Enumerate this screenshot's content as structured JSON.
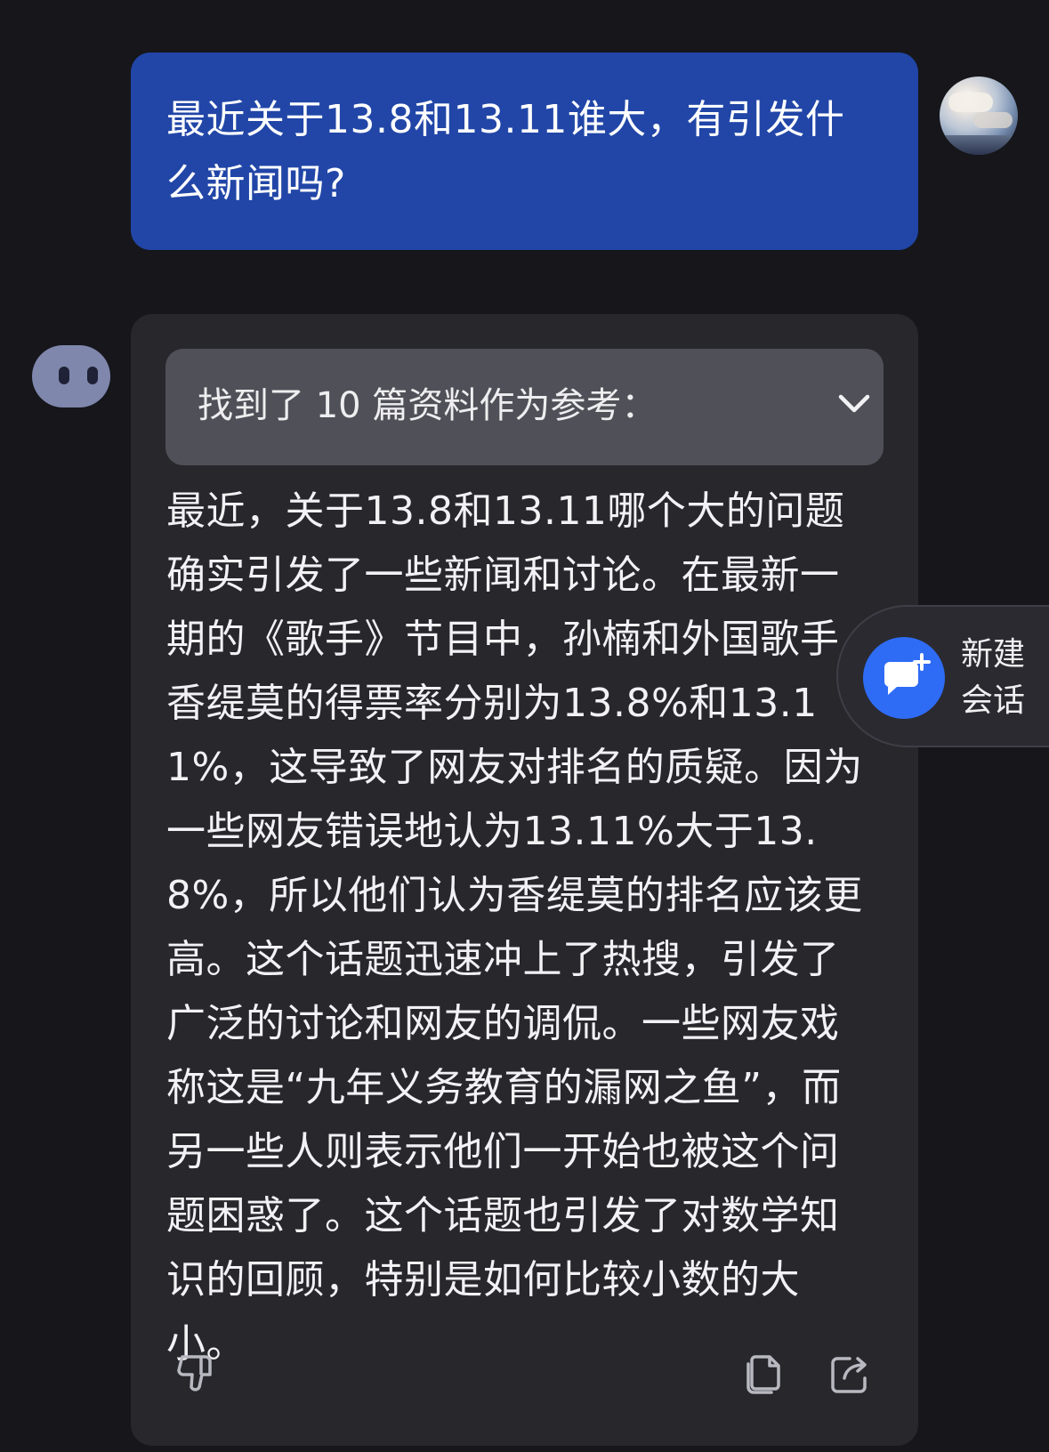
{
  "user_message": {
    "text": "最近关于13.8和13.11谁大，有引发什么新闻吗?"
  },
  "bot_message": {
    "sources_label": "找到了 10 篇资料作为参考：",
    "text": "最近，关于13.8和13.11哪个大的问题确实引发了一些新闻和讨论。在最新一期的《歌手》节目中，孙楠和外国歌手香缇莫的得票率分别为13.8%和13.11%，这导致了网友对排名的质疑。因为一些网友错误地认为13.11%大于13.8%，所以他们认为香缇莫的排名应该更高。这个话题迅速冲上了热搜，引发了广泛的讨论和网友的调侃。一些网友戏称这是“九年义务教育的漏网之鱼”，而另一些人则表示他们一开始也被这个问题困惑了。这个话题也引发了对数学知识的回顾，特别是如何比较小数的大小。"
  },
  "new_chat_button": {
    "label": "新建会话"
  },
  "icons": {
    "sources_toggle": "chevron-down-icon",
    "feedback": "thumbs-down-icon",
    "copy": "copy-icon",
    "share": "share-icon",
    "new_chat": "new-chat-icon"
  },
  "colors": {
    "background": "#16161b",
    "user_bubble": "#2146a7",
    "bot_bubble": "#27272c",
    "accent": "#2f6cf5"
  }
}
